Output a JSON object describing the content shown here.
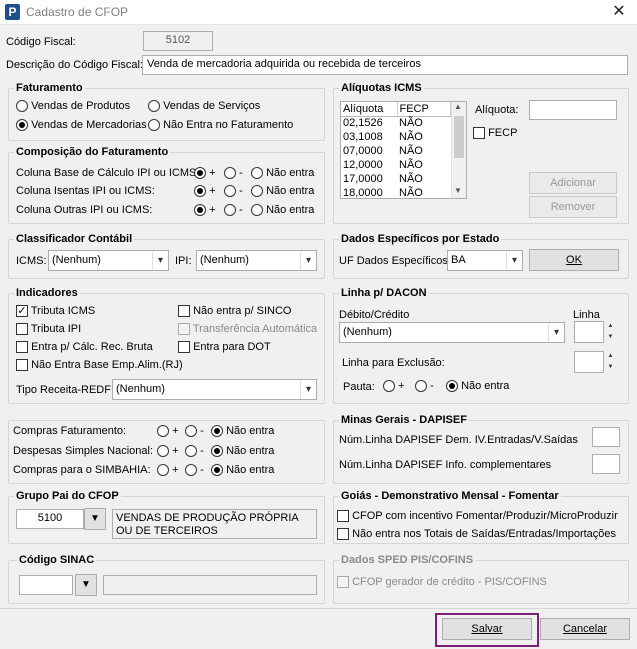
{
  "window": {
    "title": "Cadastro de CFOP",
    "app_icon_letter": "P",
    "close_glyph": "✕"
  },
  "codigo_fiscal": {
    "label": "Código Fiscal:",
    "value": "5102"
  },
  "descricao": {
    "label": "Descrição do Código Fiscal:",
    "value": "Venda de mercadoria adquirida ou recebida de terceiros"
  },
  "faturamento": {
    "title": "Faturamento",
    "options": [
      {
        "label": "Vendas de Produtos",
        "selected": false
      },
      {
        "label": "Vendas de Serviços",
        "selected": false
      },
      {
        "label": "Vendas de Mercadorias",
        "selected": true
      },
      {
        "label": "Não Entra no Faturamento",
        "selected": false
      }
    ]
  },
  "composicao": {
    "title": "Composição do Faturamento",
    "rows": [
      {
        "label": "Coluna Base de Cálculo IPI ou ICMS:",
        "plus": "+",
        "minus": "-",
        "nao": "Não entra"
      },
      {
        "label": "Coluna Isentas IPI ou ICMS:",
        "plus": "+",
        "minus": "-",
        "nao": "Não entra"
      },
      {
        "label": "Coluna Outras IPI ou ICMS:",
        "plus": "+",
        "minus": "-",
        "nao": "Não entra"
      }
    ]
  },
  "aliquotas": {
    "title": "Alíquotas ICMS",
    "columns": [
      "Alíquota",
      "FECP"
    ],
    "rows": [
      [
        "02,1526",
        "NÃO"
      ],
      [
        "03,1008",
        "NÃO"
      ],
      [
        "07,0000",
        "NÃO"
      ],
      [
        "12,0000",
        "NÃO"
      ],
      [
        "17,0000",
        "NÃO"
      ],
      [
        "18,0000",
        "NÃO"
      ]
    ],
    "aliquota_label": "Alíquota:",
    "aliquota_value": "",
    "fecp_label": "FECP",
    "adicionar": "Adicionar",
    "remover": "Remover"
  },
  "classificador": {
    "title": "Classificador Contábil",
    "icms_label": "ICMS:",
    "icms_value": "(Nenhum)",
    "ipi_label": "IPI:",
    "ipi_value": "(Nenhum)"
  },
  "dados_estado": {
    "title": "Dados Específicos por Estado",
    "uf_label": "UF Dados Específicos:",
    "uf_value": "BA",
    "ok": "OK"
  },
  "indicadores": {
    "title": "Indicadores",
    "left": [
      {
        "label": "Tributa ICMS",
        "checked": true
      },
      {
        "label": "Tributa IPI",
        "checked": false
      },
      {
        "label": "Entra p/ Cálc. Rec. Bruta",
        "checked": false
      },
      {
        "label": "Não Entra Base Emp.Alim.(RJ)",
        "checked": false
      }
    ],
    "right": [
      {
        "label": "Não entra p/ SINCO",
        "checked": false
      },
      {
        "label": "Transferência Automática",
        "checked": false,
        "disabled": true
      },
      {
        "label": "Entra para DOT",
        "checked": false
      }
    ],
    "tipo_label": "Tipo Receita-REDF:",
    "tipo_value": "(Nenhum)"
  },
  "dacon": {
    "title": "Linha p/ DACON",
    "debito_label": "Débito/Crédito",
    "debito_value": "(Nenhum)",
    "linha_label": "Linha",
    "exclusao_label": "Linha para Exclusão:",
    "pauta_label": "Pauta:",
    "plus": "+",
    "minus": "-",
    "nao": "Não entra"
  },
  "compras": {
    "rows": [
      {
        "label": "Compras Faturamento:",
        "plus": "+",
        "minus": "-",
        "nao": "Não entra"
      },
      {
        "label": "Despesas Simples Nacional:",
        "plus": "+",
        "minus": "-",
        "nao": "Não entra"
      },
      {
        "label": "Compras para o SIMBAHIA:",
        "plus": "+",
        "minus": "-",
        "nao": "Não entra"
      }
    ]
  },
  "minas": {
    "title": "Minas Gerais - DAPISEF",
    "row1": "Núm.Linha DAPISEF Dem. IV.Entradas/V.Saídas",
    "row2": "Núm.Linha DAPISEF Info. complementares"
  },
  "grupo_pai": {
    "title": "Grupo Pai do CFOP",
    "code": "5100",
    "desc": "VENDAS DE PRODUÇÃO PRÓPRIA OU DE TERCEIROS"
  },
  "goias": {
    "title": "Goiás - Demonstrativo Mensal - Fomentar",
    "c1": "CFOP com incentivo  Fomentar/Produzir/MicroProduzir",
    "c2": "Não entra nos Totais de  Saídas/Entradas/Importações"
  },
  "sinac": {
    "title": "Código SINAC"
  },
  "sped": {
    "title": "Dados SPED PIS/COFINS",
    "c1": "CFOP gerador de crédito - PIS/COFINS"
  },
  "footer": {
    "salvar": "Salvar",
    "cancelar": "Cancelar",
    "focus_color": "#7a1f7a"
  }
}
